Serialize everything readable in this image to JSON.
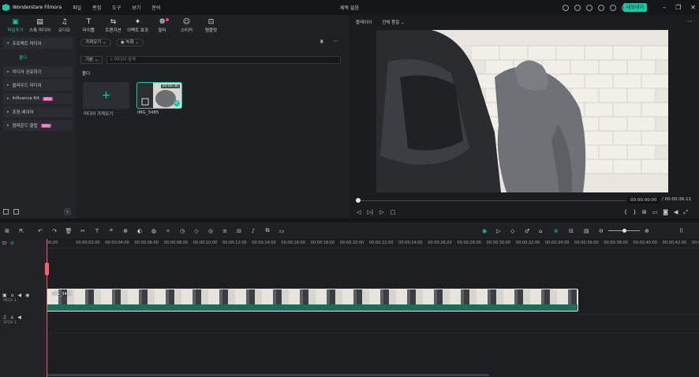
{
  "app": {
    "name": "Wonderstare Filmora",
    "doc_title": "제목 없음",
    "export": "내보내기"
  },
  "menu": [
    "파일",
    "편집",
    "도구",
    "보기",
    "문의"
  ],
  "toolbar": [
    {
      "icon": "media-icon",
      "label": "파일추가",
      "glyph": "▣",
      "active": true
    },
    {
      "icon": "stock-media-icon",
      "label": "스톡 미디어",
      "glyph": "▤"
    },
    {
      "icon": "audio-icon",
      "label": "오디오",
      "glyph": "♫"
    },
    {
      "icon": "title-icon",
      "label": "타이틀",
      "glyph": "T"
    },
    {
      "icon": "transition-icon",
      "label": "트랜지션",
      "glyph": "⇆"
    },
    {
      "icon": "effects-icon",
      "label": "이펙트 효과",
      "glyph": "✦"
    },
    {
      "icon": "filter-icon",
      "label": "필터",
      "glyph": "❁",
      "dot": true
    },
    {
      "icon": "sticker-icon",
      "label": "스티커",
      "glyph": "☺"
    },
    {
      "icon": "template-icon",
      "label": "템플릿",
      "glyph": "⊡"
    }
  ],
  "sidebar": {
    "items": [
      {
        "label": "프로젝트 미디어",
        "caret": "▾"
      },
      {
        "label": "미디어 공유하기",
        "caret": "▸"
      },
      {
        "label": "클라우드 미디어",
        "caret": "▸"
      },
      {
        "label": "Influence Kit",
        "caret": "▸",
        "badge": "NEW"
      },
      {
        "label": "조정 레이어",
        "caret": "▸"
      },
      {
        "label": "컴파운드 클립",
        "caret": "▸",
        "badge": "NEW"
      }
    ],
    "sub": "폴더"
  },
  "media": {
    "import_pill": "가져오기 ⌄",
    "record_pill": "◉ 녹화 ⌄",
    "sort_pill": "기본 ⌄",
    "search_placeholder": "미디어 검색",
    "folder": "폴더",
    "import_label": "미디어 가져오기",
    "clip": {
      "name": "IMG_3485",
      "duration": "00:00:36"
    }
  },
  "player": {
    "tab": "플레이어",
    "quality": "전체 품질 ⌄",
    "current": "00:00:00:00",
    "total": "/ 00:00:36:11",
    "playhead_fraction": 0.0
  },
  "timeline": {
    "ruler": [
      "00:00",
      "00:00:02:00",
      "00:00:04:00",
      "00:00:06:00",
      "00:00:08:00",
      "00:00:10:00",
      "00:00:12:00",
      "00:00:14:00",
      "00:00:16:00",
      "00:00:18:00",
      "00:00:20:00",
      "00:00:22:00",
      "00:00:24:00",
      "00:00:26:00",
      "00:00:28:00",
      "00:00:30:00",
      "00:00:32:00",
      "00:00:34:00",
      "00:00:36:00",
      "00:00:38:00",
      "00:00:40:00",
      "00:00:42:00",
      "00:00:44"
    ],
    "video_track": "비디오 1",
    "audio_track": "오디오 1",
    "clip_name": "IMG_3485"
  }
}
